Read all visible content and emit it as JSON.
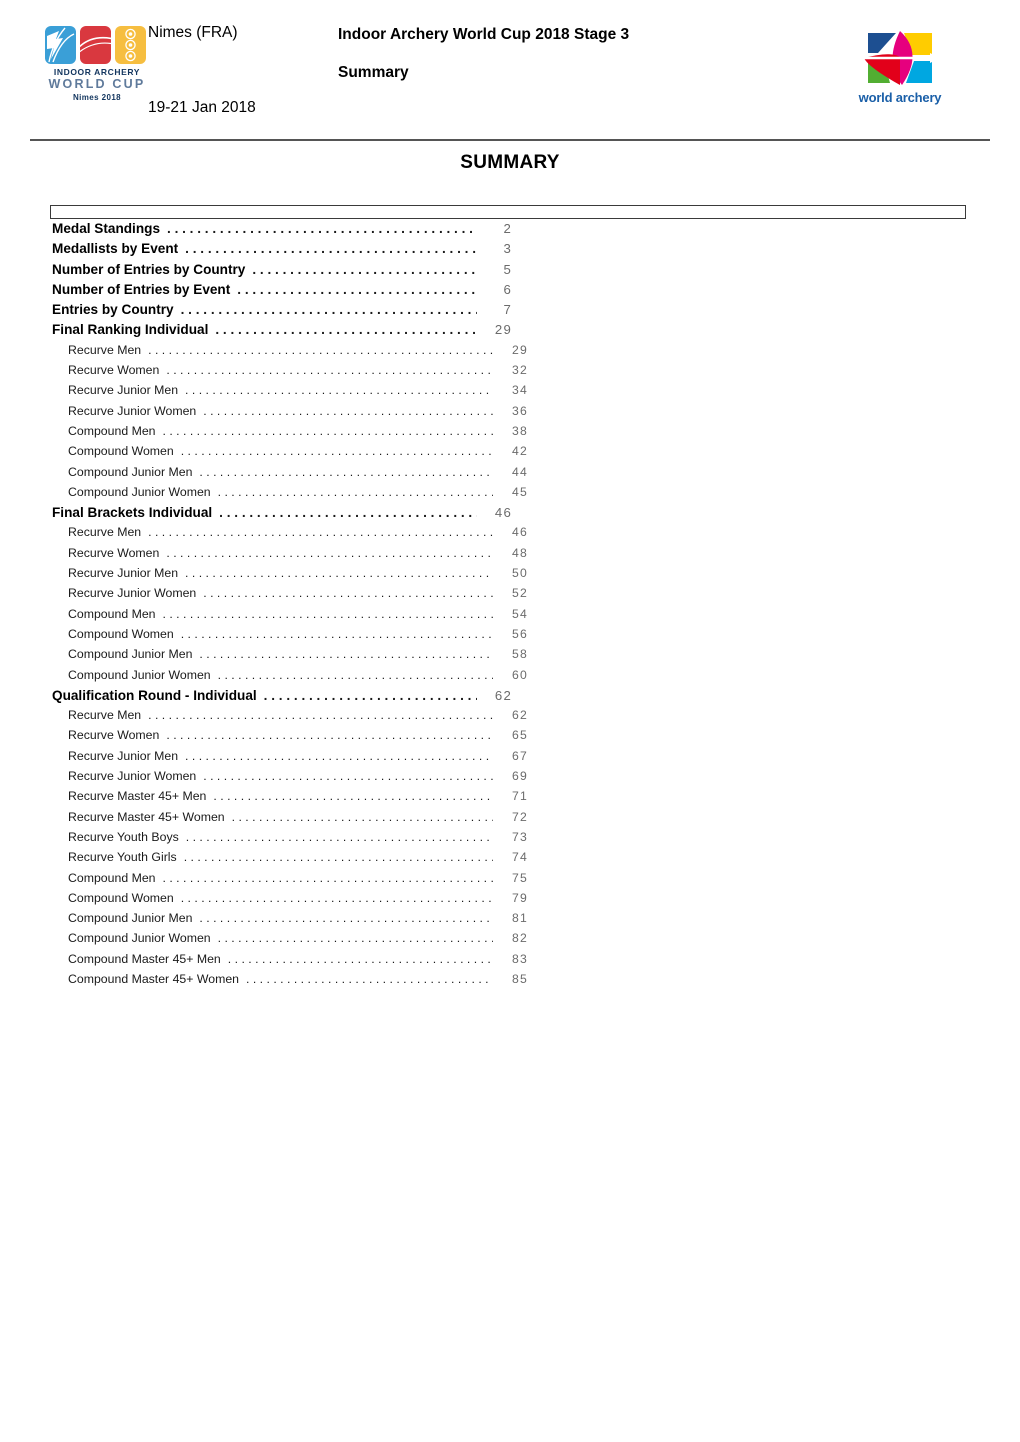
{
  "header": {
    "venue": "Nimes (FRA)",
    "dates": "19-21 Jan 2018",
    "title": "Indoor Archery World Cup 2018 Stage 3",
    "subtitle": "Summary",
    "event_logo": {
      "line1": "INDOOR ARCHERY",
      "line2": "WORLD CUP",
      "line3": "Nimes 2018",
      "colors": {
        "blue": "#3a9fd7",
        "red": "#d9383f",
        "amber": "#f6be40",
        "navy": "#12355e",
        "slate": "#5f7a9b"
      }
    },
    "federation_logo": {
      "text": "world archery",
      "colors": {
        "blue": "#1a5fa8",
        "magenta": "#e6007e",
        "yellow": "#ffcc00",
        "red": "#e2001a",
        "green": "#52ae32",
        "cyan": "#00a7e1",
        "darkblue": "#1d4f91"
      }
    }
  },
  "page_title": "SUMMARY",
  "toc": [
    {
      "level": 1,
      "label": "Medal Standings",
      "page": "2"
    },
    {
      "level": 1,
      "label": "Medallists by Event",
      "page": "3"
    },
    {
      "level": 1,
      "label": "Number of Entries by Country",
      "page": "5"
    },
    {
      "level": 1,
      "label": "Number of Entries by Event",
      "page": "6"
    },
    {
      "level": 1,
      "label": "Entries by Country",
      "page": "7"
    },
    {
      "level": 1,
      "label": "Final Ranking Individual",
      "page": "29"
    },
    {
      "level": 2,
      "label": "Recurve Men",
      "page": "29"
    },
    {
      "level": 2,
      "label": "Recurve Women",
      "page": "32"
    },
    {
      "level": 2,
      "label": "Recurve Junior Men",
      "page": "34"
    },
    {
      "level": 2,
      "label": "Recurve Junior Women",
      "page": "36"
    },
    {
      "level": 2,
      "label": "Compound Men",
      "page": "38"
    },
    {
      "level": 2,
      "label": "Compound Women",
      "page": "42"
    },
    {
      "level": 2,
      "label": "Compound Junior Men",
      "page": "44"
    },
    {
      "level": 2,
      "label": "Compound Junior Women",
      "page": "45"
    },
    {
      "level": 1,
      "label": "Final Brackets Individual",
      "page": "46"
    },
    {
      "level": 2,
      "label": "Recurve Men",
      "page": "46"
    },
    {
      "level": 2,
      "label": "Recurve Women",
      "page": "48"
    },
    {
      "level": 2,
      "label": "Recurve Junior Men",
      "page": "50"
    },
    {
      "level": 2,
      "label": "Recurve Junior Women",
      "page": "52"
    },
    {
      "level": 2,
      "label": "Compound Men",
      "page": "54"
    },
    {
      "level": 2,
      "label": "Compound Women",
      "page": "56"
    },
    {
      "level": 2,
      "label": "Compound Junior Men",
      "page": "58"
    },
    {
      "level": 2,
      "label": "Compound Junior Women",
      "page": "60"
    },
    {
      "level": 1,
      "label": "Qualification Round - Individual",
      "page": "62"
    },
    {
      "level": 2,
      "label": "Recurve Men",
      "page": "62"
    },
    {
      "level": 2,
      "label": "Recurve Women",
      "page": "65"
    },
    {
      "level": 2,
      "label": "Recurve Junior Men",
      "page": "67"
    },
    {
      "level": 2,
      "label": "Recurve Junior Women",
      "page": "69"
    },
    {
      "level": 2,
      "label": "Recurve Master 45+ Men",
      "page": "71"
    },
    {
      "level": 2,
      "label": "Recurve Master 45+ Women",
      "page": "72"
    },
    {
      "level": 2,
      "label": "Recurve Youth Boys",
      "page": "73"
    },
    {
      "level": 2,
      "label": "Recurve Youth Girls",
      "page": "74"
    },
    {
      "level": 2,
      "label": "Compound Men",
      "page": "75"
    },
    {
      "level": 2,
      "label": "Compound Women",
      "page": "79"
    },
    {
      "level": 2,
      "label": "Compound Junior Men",
      "page": "81"
    },
    {
      "level": 2,
      "label": "Compound Junior Women",
      "page": "82"
    },
    {
      "level": 2,
      "label": "Compound Master 45+ Men",
      "page": "83"
    },
    {
      "level": 2,
      "label": "Compound Master 45+ Women",
      "page": "85"
    }
  ]
}
